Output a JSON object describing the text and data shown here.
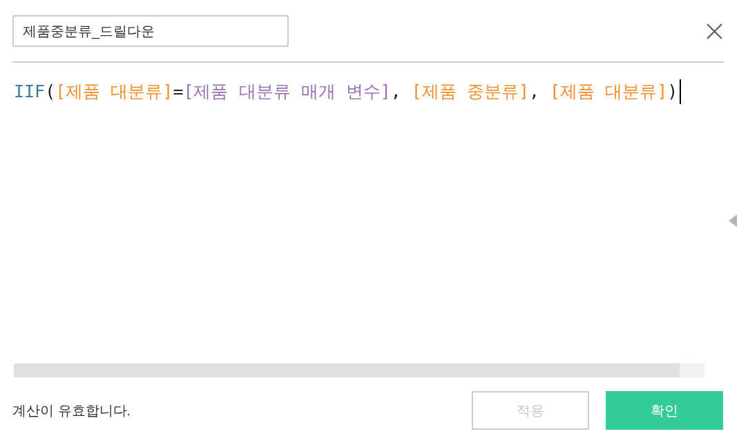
{
  "name_field": {
    "value": "제품중분류_드릴다운"
  },
  "editor": {
    "focused": true,
    "tokens": [
      {
        "text": "IIF",
        "kind": "function"
      },
      {
        "text": "(",
        "kind": "punctuation"
      },
      {
        "text": "[제품 대분류]",
        "kind": "field"
      },
      {
        "text": "=",
        "kind": "operator"
      },
      {
        "text": "[제품 대분류 매개 변수]",
        "kind": "parameter"
      },
      {
        "text": ", ",
        "kind": "punctuation"
      },
      {
        "text": "[제품 중분류]",
        "kind": "field"
      },
      {
        "text": ", ",
        "kind": "punctuation"
      },
      {
        "text": "[제품 대분류]",
        "kind": "field"
      },
      {
        "text": ")",
        "kind": "punctuation"
      }
    ]
  },
  "function_panel": {
    "expanded": false
  },
  "status": {
    "text": "계산이 유효합니다."
  },
  "buttons": [
    {
      "label": "적용",
      "kind": "secondary",
      "disabled": true
    },
    {
      "label": "확인",
      "kind": "primary",
      "disabled": false
    }
  ]
}
